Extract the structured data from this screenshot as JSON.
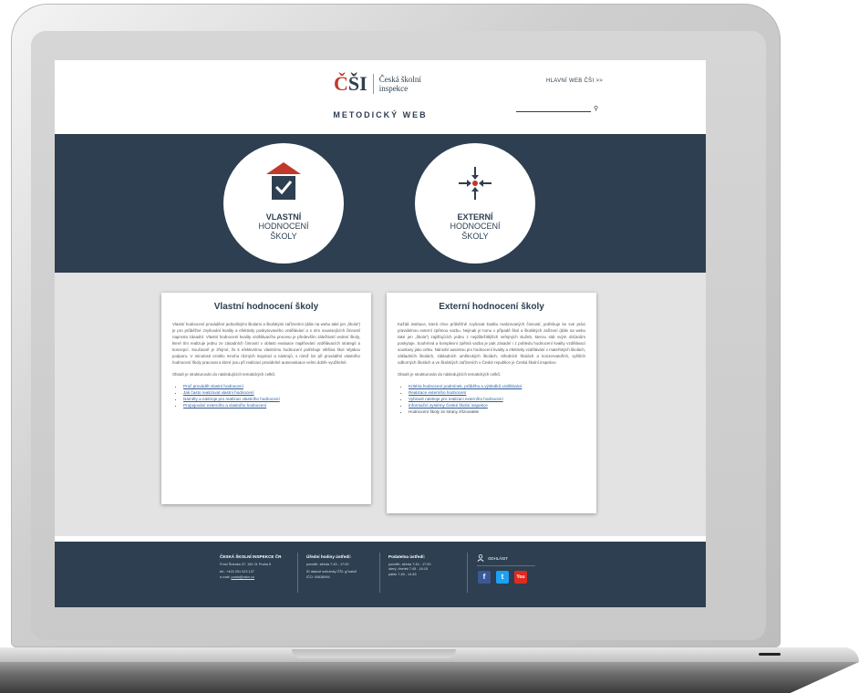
{
  "header": {
    "logo_mark_c": "Č",
    "logo_mark_si": "ŠI",
    "logo_text_line1": "Česká školní",
    "logo_text_line2": "inspekce",
    "subtitle": "METODICKÝ WEB",
    "top_link": "HLAVNÍ WEB ČŠI >>",
    "search_icon": "⚲"
  },
  "hero": {
    "internal": {
      "bold": "VLASTNÍ",
      "line2": "HODNOCENÍ",
      "line3": "ŠKOLY"
    },
    "external": {
      "bold": "EXTERNÍ",
      "line2": "HODNOCENÍ",
      "line3": "ŠKOLY"
    }
  },
  "cards": {
    "internal": {
      "title": "Vlastní hodnocení školy",
      "paragraph": "Vlastní hodnocení prováděné jednotlivými školami a školskými zařízeními (dále na webu také jen „škola“) je pro průběžné zvyšování kvality a efektivity poskytovaného vzdělávání a s ním souvisejících činností naprosto zásadní. Vlastní hodnocení kvality vzdělávacího procesu je především záležitostí vedení školy, které tím realizuje jednu ze zásadních činností v oblasti evaluace naplňování vzdělávacích strategií a koncepcí. Současně je zřejmé, že k efektivnímu vlastnímu hodnocení potřebuje většina škol nějakou podporu. V minulosti vzniklo mnoho různých inspirací a nástrojů, s nimiž lze při provádění vlastního hodnocení školy pracovat a které jsou při realizaci pravidelné autoevaluace velmi dobře využitelné.",
      "intro": "Obsah je strukturován do následujících tematických celků:",
      "links": [
        "Proč provádět vlastní hodnocení",
        "Jak často realizovat vlastní hodnocení",
        "Náměty a nástroje pro realizaci vlastního hodnocení",
        "Propojování externího a vlastního hodnocení"
      ]
    },
    "external": {
      "title": "Externí hodnocení školy",
      "paragraph": "Každá instituce, která chce průběžně zvyšovat kvalitu realizovaných činností, potřebuje ke své práci pravidelnou externí zpětnou vazbu. Nejinak je tomu v případě škol a školských zařízení (dále na webu také jen „škola“) zajišťujících jednu z nejdůležitějších veřejných služeb, kterou stát svým občanům poskytuje. Souhrnná a komplexní zpětná vazba je pak zásadní i z pohledu hodnocení kvality vzdělávací soustavy jako celku. Národní autoritou pro hodnocení kvality a efektivity vzdělávání v mateřských školách, základních školách, základních uměleckých školách, středních školách a konzervatořích, vyšších odborných školách a ve školských zařízeních v České republice je Česká školní inspekce.",
      "intro": "Obsah je strukturován do následujících tematických celků:",
      "links": [
        "Kritéria hodnocení podmínek, průběhu a výsledků vzdělávání",
        "Realizace externího hodnocení",
        "Vybrané nástroje pro realizaci externího hodnocení",
        "Informační systémy České školní inspekce"
      ],
      "plain_item": "Hodnocení školy ze strany zřizovatele"
    }
  },
  "footer": {
    "org": {
      "title": "ČESKÁ ŠKOLNÍ INSPEKCE ČR",
      "address": "Fráni Šrámka 37, 150 21 Praha 5",
      "phone": "tel.: +420 251 023 137",
      "email_label": "e-mail:",
      "email": "posta@csicr.cz"
    },
    "hours": {
      "title": "Úřední hodiny ústředí:",
      "line1": "pondělí, středa   7:45 - 17:00",
      "line2": "ID datové schránky ČŠI: g7zais9",
      "line3": "IČO: 00638994"
    },
    "filing": {
      "title": "Podatelna ústředí:",
      "line1": "pondělí, středa   7:45 - 17:00",
      "line2": "úterý, čtvrtek   7:45 - 16:15",
      "line3": "pátek   7:45 - 14:45"
    },
    "login_label": "ODHLÁSIT",
    "social": {
      "facebook": "f",
      "twitter": "t",
      "youtube": "You"
    }
  }
}
